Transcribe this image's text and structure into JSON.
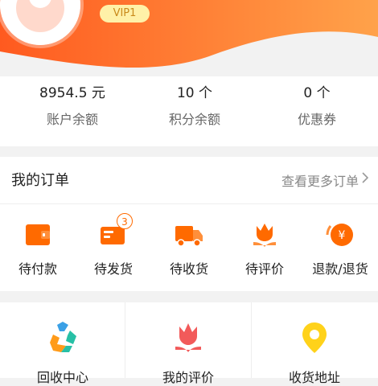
{
  "header": {
    "vip_label": "VIP1",
    "gradient_from": "#ff5a1f",
    "gradient_to": "#ffa24a"
  },
  "stats": [
    {
      "value": "8954.5 元",
      "label": "账户余额"
    },
    {
      "value": "10 个",
      "label": "积分余额"
    },
    {
      "value": "0 个",
      "label": "优惠券"
    }
  ],
  "orders": {
    "title": "我的订单",
    "more_label": "查看更多订单",
    "items": [
      {
        "label": "待付款",
        "icon": "wallet-icon"
      },
      {
        "label": "待发货",
        "icon": "package-icon",
        "badge": "3"
      },
      {
        "label": "待收货",
        "icon": "truck-icon"
      },
      {
        "label": "待评价",
        "icon": "tulip-icon"
      },
      {
        "label": "退款/退货",
        "icon": "refund-coin-icon"
      }
    ]
  },
  "tools": [
    {
      "label": "回收中心",
      "icon": "recycle-icon"
    },
    {
      "label": "我的评价",
      "icon": "tulip-icon"
    },
    {
      "label": "收货地址",
      "icon": "location-pin-icon"
    }
  ],
  "colors": {
    "accent": "#ff6a00",
    "pin": "#ffd21a",
    "tulip_red": "#f25a5a"
  }
}
